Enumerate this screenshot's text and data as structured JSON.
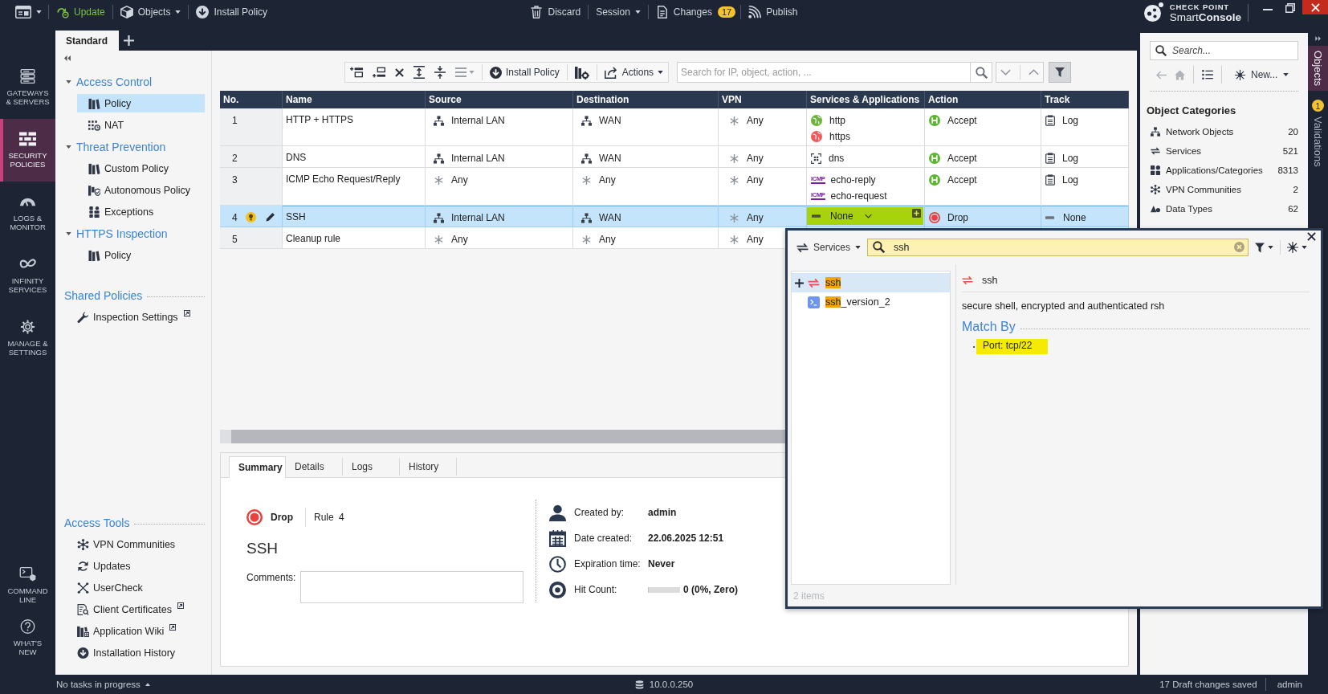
{
  "top_bar": {
    "left_items": [
      {
        "label": "Update",
        "kind": "update"
      },
      {
        "label": "Objects",
        "kind": "objects"
      },
      {
        "label": "Install Policy",
        "kind": "install"
      }
    ],
    "center_items": [
      {
        "label": "Discard",
        "kind": "discard"
      },
      {
        "label": "Session",
        "kind": "session"
      },
      {
        "label": "Changes",
        "kind": "changes",
        "badge": "17"
      },
      {
        "label": "Publish",
        "kind": "publish"
      }
    ],
    "logo": {
      "brand": "CHECK POINT",
      "product": "Smart**Console**"
    }
  },
  "policy_tabs": [
    {
      "label": "Standard",
      "selected": true
    }
  ],
  "nav": [
    {
      "label": "GATEWAYS & SERVERS",
      "kind": "gateways",
      "selected": false
    },
    {
      "label": "SECURITY POLICIES",
      "kind": "policies",
      "selected": true
    },
    {
      "label": "LOGS & MONITOR",
      "kind": "logs",
      "selected": false
    },
    {
      "label": "INFINITY SERVICES",
      "kind": "infinity",
      "selected": false
    },
    {
      "label": "MANAGE & SETTINGS",
      "kind": "manage",
      "selected": false
    }
  ],
  "nav_bottom": [
    {
      "label": "COMMAND LINE",
      "kind": "command"
    },
    {
      "label": "WHAT'S NEW",
      "kind": "whatsnew"
    }
  ],
  "tree": [
    {
      "title": "Access Control",
      "expanded": true,
      "children": [
        {
          "label": "Policy",
          "kind": "policy",
          "selected": true
        },
        {
          "label": "NAT",
          "kind": "nat",
          "selected": false
        }
      ]
    },
    {
      "title": "Threat Prevention",
      "expanded": true,
      "children": [
        {
          "label": "Custom Policy",
          "kind": "policy",
          "selected": false
        },
        {
          "label": "Autonomous Policy",
          "kind": "autonomous",
          "selected": false
        },
        {
          "label": "Exceptions",
          "kind": "exceptions",
          "selected": false
        }
      ]
    },
    {
      "title": "HTTPS Inspection",
      "expanded": true,
      "children": [
        {
          "label": "Policy",
          "kind": "policy",
          "selected": false
        }
      ]
    }
  ],
  "shared_policies": {
    "title": "Shared Policies",
    "items": [
      {
        "label": "Inspection Settings",
        "kind": "settings",
        "external": true
      }
    ]
  },
  "access_tools": {
    "title": "Access Tools",
    "items": [
      {
        "label": "VPN Communities",
        "kind": "vpn",
        "external": false
      },
      {
        "label": "Updates",
        "kind": "updates",
        "external": false
      },
      {
        "label": "UserCheck",
        "kind": "usercheck",
        "external": false
      },
      {
        "label": "Client Certificates",
        "kind": "certificates",
        "external": true
      },
      {
        "label": "Application Wiki",
        "kind": "wiki",
        "external": true
      },
      {
        "label": "Installation History",
        "kind": "history",
        "external": false
      }
    ]
  },
  "rule_toolbar": {
    "install_label": "Install Policy",
    "actions_label": "Actions",
    "search_placeholder": "Search for IP, object, action, ...",
    "filter_active": true
  },
  "rulebase": {
    "columns": [
      "No.",
      "Name",
      "Source",
      "Destination",
      "VPN",
      "Services & Applications",
      "Action",
      "Track"
    ],
    "rows": [
      {
        "no": "1",
        "name": "HTTP + HTTPS",
        "selected": false,
        "tip": false,
        "edited": false,
        "source": [
          {
            "label": "Internal LAN",
            "kind": "network"
          }
        ],
        "destination": [
          {
            "label": "WAN",
            "kind": "network"
          }
        ],
        "vpn": [
          {
            "label": "Any",
            "kind": "any"
          }
        ],
        "services": [
          {
            "label": "http",
            "kind": "web",
            "editing": false
          },
          {
            "label": "https",
            "kind": "web_secure",
            "editing": false
          }
        ],
        "action": {
          "label": "Accept",
          "kind": "accept"
        },
        "track": {
          "label": "Log",
          "kind": "log"
        }
      },
      {
        "no": "2",
        "name": "DNS",
        "selected": false,
        "tip": false,
        "edited": false,
        "source": [
          {
            "label": "Internal LAN",
            "kind": "network"
          }
        ],
        "destination": [
          {
            "label": "WAN",
            "kind": "network"
          }
        ],
        "vpn": [
          {
            "label": "Any",
            "kind": "any"
          }
        ],
        "services": [
          {
            "label": "dns",
            "kind": "dns",
            "editing": false
          }
        ],
        "action": {
          "label": "Accept",
          "kind": "accept"
        },
        "track": {
          "label": "Log",
          "kind": "log"
        }
      },
      {
        "no": "3",
        "name": "ICMP Echo Request/Reply",
        "selected": false,
        "tip": false,
        "edited": false,
        "source": [
          {
            "label": "Any",
            "kind": "any"
          }
        ],
        "destination": [
          {
            "label": "Any",
            "kind": "any"
          }
        ],
        "vpn": [
          {
            "label": "Any",
            "kind": "any"
          }
        ],
        "services": [
          {
            "label": "echo-reply",
            "kind": "icmp",
            "tag": "ICMP",
            "editing": false
          },
          {
            "label": "echo-request",
            "kind": "icmp",
            "tag": "ICMP",
            "editing": false
          }
        ],
        "action": {
          "label": "Accept",
          "kind": "accept"
        },
        "track": {
          "label": "Log",
          "kind": "log"
        }
      },
      {
        "no": "4",
        "name": "SSH",
        "selected": true,
        "tip": true,
        "edited": true,
        "source": [
          {
            "label": "Internal LAN",
            "kind": "network"
          }
        ],
        "destination": [
          {
            "label": "WAN",
            "kind": "network"
          }
        ],
        "vpn": [
          {
            "label": "Any",
            "kind": "any"
          }
        ],
        "services": [
          {
            "label": "None",
            "kind": "none",
            "editing": true
          }
        ],
        "action": {
          "label": "Drop",
          "kind": "drop"
        },
        "track": {
          "label": "None",
          "kind": "none"
        }
      },
      {
        "no": "5",
        "name": "Cleanup rule",
        "selected": false,
        "tip": false,
        "edited": false,
        "source": [
          {
            "label": "Any",
            "kind": "any"
          }
        ],
        "destination": [
          {
            "label": "Any",
            "kind": "any"
          }
        ],
        "vpn": [
          {
            "label": "Any",
            "kind": "any"
          }
        ]
      }
    ]
  },
  "detail_tabs": [
    {
      "label": "Summary",
      "selected": true
    },
    {
      "label": "Details",
      "selected": false
    },
    {
      "label": "Logs",
      "selected": false
    },
    {
      "label": "History",
      "selected": false
    }
  ],
  "summary": {
    "action": {
      "label": "Drop",
      "kind": "drop"
    },
    "rule": "Rule 4",
    "name": "SSH",
    "comments_label": "Comments:",
    "facts": [
      {
        "label": "Created by:",
        "value": "admin",
        "kind": "user"
      },
      {
        "label": "Date created:",
        "value": "22.06.2025 12:51",
        "kind": "calendar"
      },
      {
        "label": "Expiration time:",
        "value": "Never",
        "kind": "clock"
      },
      {
        "label": "Hit Count:",
        "value": "0 (0%, Zero)",
        "kind": "hits",
        "level": 0
      }
    ]
  },
  "objects_panel": {
    "search_placeholder": "Search...",
    "new_label": "New...",
    "heading": "Object Categories",
    "categories": [
      {
        "label": "Network Objects",
        "count": "20",
        "kind": "network"
      },
      {
        "label": "Services",
        "count": "521",
        "kind": "services"
      },
      {
        "label": "Applications/Categories",
        "count": "8313",
        "kind": "apps"
      },
      {
        "label": "VPN Communities",
        "count": "2",
        "kind": "vpn"
      },
      {
        "label": "Data Types",
        "count": "62",
        "kind": "data"
      }
    ]
  },
  "side_tabs": [
    {
      "label": "Objects",
      "selected": true
    },
    {
      "label": "Validations",
      "selected": false,
      "badge": "1"
    }
  ],
  "object_picker": {
    "type_label": "Services",
    "query": "ssh",
    "results": [
      {
        "match": "ssh",
        "kind": "tcp",
        "selected": true
      },
      {
        "match": "ssh",
        "rest": "_version_2",
        "kind": "other",
        "selected": false
      }
    ],
    "detail": {
      "name": "ssh",
      "kind": "tcp",
      "description": "secure shell, encrypted and authenticated rsh",
      "section": "Match By",
      "bullets": [
        {
          "text": "Port: tcp/22",
          "highlighted": true
        }
      ]
    },
    "footer": "2 items"
  },
  "status_bar": {
    "tasks": "No tasks in progress",
    "server": "10.0.0.250",
    "drafts": "17 Draft changes saved",
    "user": "admin"
  }
}
